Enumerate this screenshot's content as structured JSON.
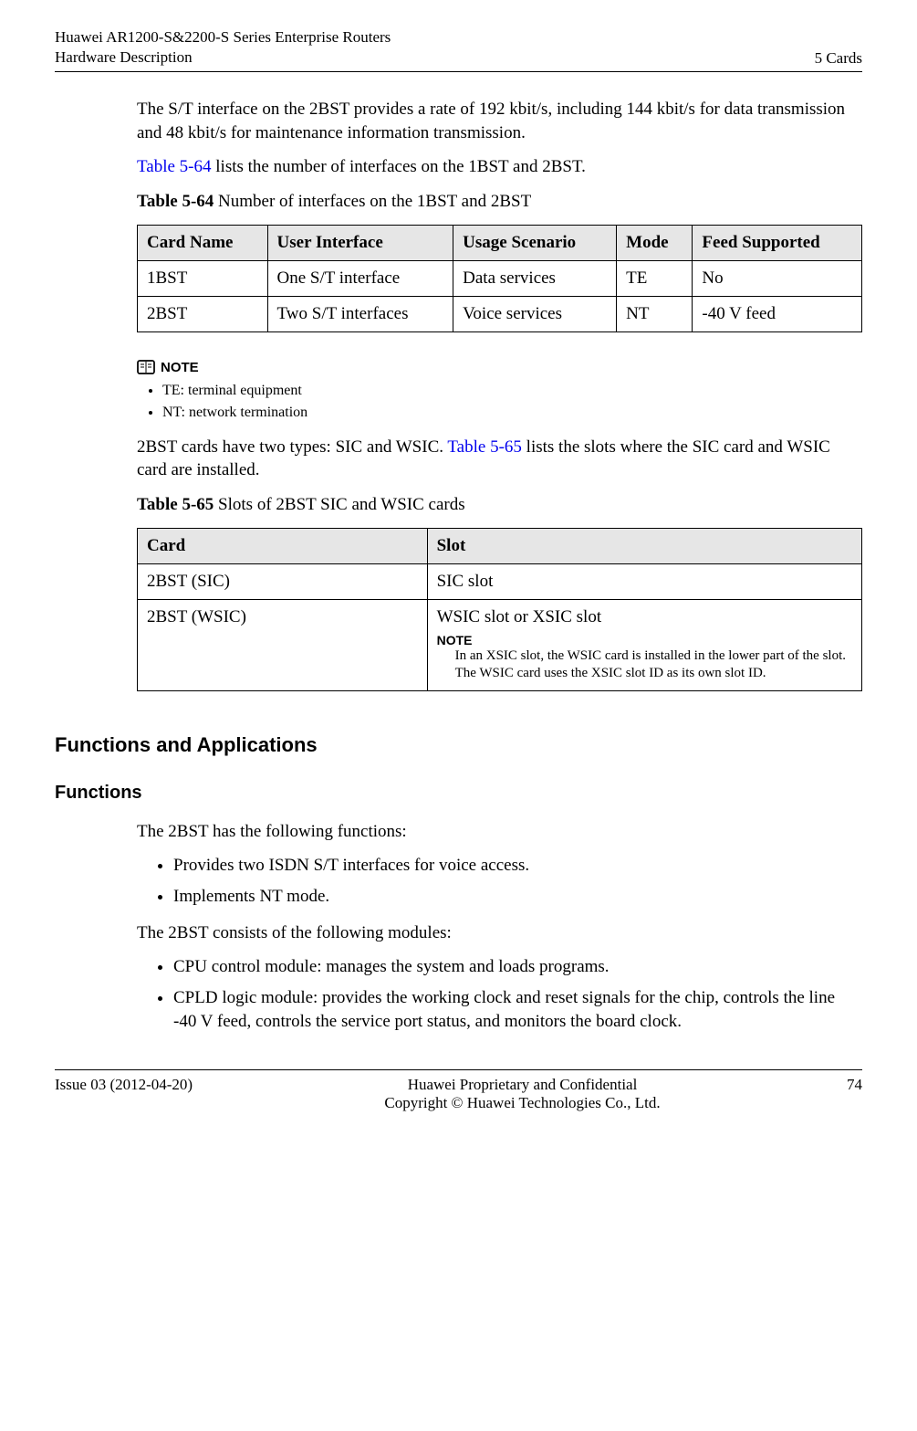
{
  "header": {
    "line1": "Huawei AR1200-S&2200-S Series Enterprise Routers",
    "line2": "Hardware Description",
    "right": "5 Cards"
  },
  "intro": {
    "p1": "The S/T interface on the 2BST provides a rate of 192 kbit/s, including 144 kbit/s for data transmission and 48 kbit/s for maintenance information transmission.",
    "p2_link": "Table 5-64",
    "p2_rest": " lists the number of interfaces on the 1BST and 2BST."
  },
  "table64": {
    "caption_bold": "Table 5-64",
    "caption_rest": " Number of interfaces on the 1BST and 2BST",
    "headers": [
      "Card Name",
      "User Interface",
      "Usage Scenario",
      "Mode",
      "Feed Supported"
    ],
    "rows": [
      [
        "1BST",
        "One S/T interface",
        "Data services",
        "TE",
        "No"
      ],
      [
        "2BST",
        "Two S/T interfaces",
        "Voice services",
        "NT",
        "-40 V feed"
      ]
    ]
  },
  "note1": {
    "label": "NOTE",
    "items": [
      "TE: terminal equipment",
      "NT: network termination"
    ]
  },
  "intro2": {
    "pre": "2BST cards have two types: SIC and WSIC. ",
    "link": "Table 5-65",
    "post": " lists the slots where the SIC card and WSIC card are installed."
  },
  "table65": {
    "caption_bold": "Table 5-65",
    "caption_rest": " Slots of 2BST SIC and WSIC cards",
    "headers": [
      "Card",
      "Slot"
    ],
    "row1": [
      "2BST (SIC)",
      "SIC slot"
    ],
    "row2_card": "2BST (WSIC)",
    "row2_slot_main": "WSIC slot or XSIC slot",
    "row2_note_label": "NOTE",
    "row2_note_body": "In an XSIC slot, the WSIC card is installed in the lower part of the slot. The WSIC card uses the XSIC slot ID as its own slot ID."
  },
  "sections": {
    "h2": "Functions and Applications",
    "h3": "Functions",
    "p_funcs": "The 2BST has the following functions:",
    "funcs": [
      "Provides two ISDN S/T interfaces for voice access.",
      "Implements NT mode."
    ],
    "p_modules": "The 2BST consists of the following modules:",
    "modules": [
      "CPU control module: manages the system and loads programs.",
      "CPLD logic module: provides the working clock and reset signals for the chip, controls the line -40 V feed, controls the service port status, and monitors the board clock."
    ]
  },
  "footer": {
    "left": "Issue 03 (2012-04-20)",
    "center1": "Huawei Proprietary and Confidential",
    "center2": "Copyright © Huawei Technologies Co., Ltd.",
    "right": "74"
  }
}
